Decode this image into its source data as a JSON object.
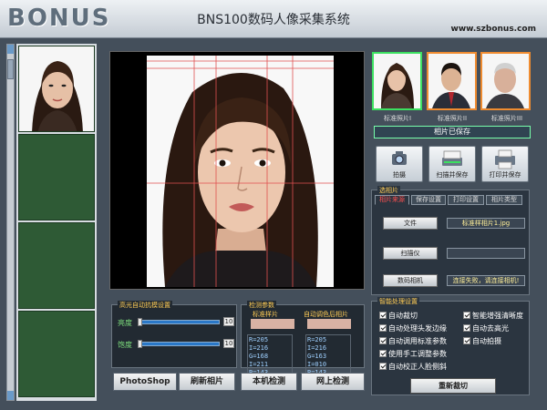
{
  "app": {
    "brand": "BONUS",
    "title": "BNS100数码人像采集系统",
    "site": "www.szbonus.com"
  },
  "exposure": {
    "title": "高光自动抗模设置",
    "brightness_label": "亮度",
    "brightness_value": "10",
    "contrast_label": "饱度",
    "contrast_value": "10"
  },
  "detection": {
    "title": "检测参数",
    "standard_label": "标准样片",
    "auto_label": "自动调色后相片",
    "standard_rgb": [
      "R=205  I=216",
      "G=168  I=211",
      "B=143  I=617"
    ],
    "auto_rgb": [
      "R=205  I=216",
      "G=163  I=010",
      "B=143  I=617"
    ]
  },
  "bottom_buttons": [
    "PhotoShop",
    "刷新相片",
    "本机检测",
    "网上检测"
  ],
  "samples": [
    {
      "label": "标准照片I"
    },
    {
      "label": "标准照片II"
    },
    {
      "label": "标准照片III"
    }
  ],
  "status": {
    "saved": "相片已保存"
  },
  "tools": [
    {
      "label": "拍摄"
    },
    {
      "label": "扫描并保存"
    },
    {
      "label": "打印并保存"
    }
  ],
  "tabs_panel": {
    "title": "选相片",
    "tabs": [
      "相片来源",
      "保存设置",
      "打印设置",
      "相片类型"
    ],
    "sources": [
      {
        "button": "文件",
        "value": "标准样相片1.jpg"
      },
      {
        "button": "扫描仪",
        "value": ""
      },
      {
        "button": "数码相机",
        "value": "连接失败，请连接相机!"
      }
    ]
  },
  "options": {
    "title": "智能处理设置",
    "items": [
      {
        "label": "自动裁切",
        "checked": true
      },
      {
        "label": "智能增强清晰度",
        "checked": true
      },
      {
        "label": "自动处理头发边缘",
        "checked": true
      },
      {
        "label": "自动去高光",
        "checked": true
      },
      {
        "label": "自动调用标准参数",
        "checked": true
      },
      {
        "label": "自动拍摄",
        "checked": true
      },
      {
        "label": "使用手工调整参数",
        "checked": true
      },
      {
        "label": "自动校正人脸侧斜",
        "checked": true
      }
    ],
    "recrop": "重新裁切"
  },
  "colors": {
    "accent": "#3ce060",
    "panel": "#2b3540",
    "highlight": "#ff5050"
  }
}
